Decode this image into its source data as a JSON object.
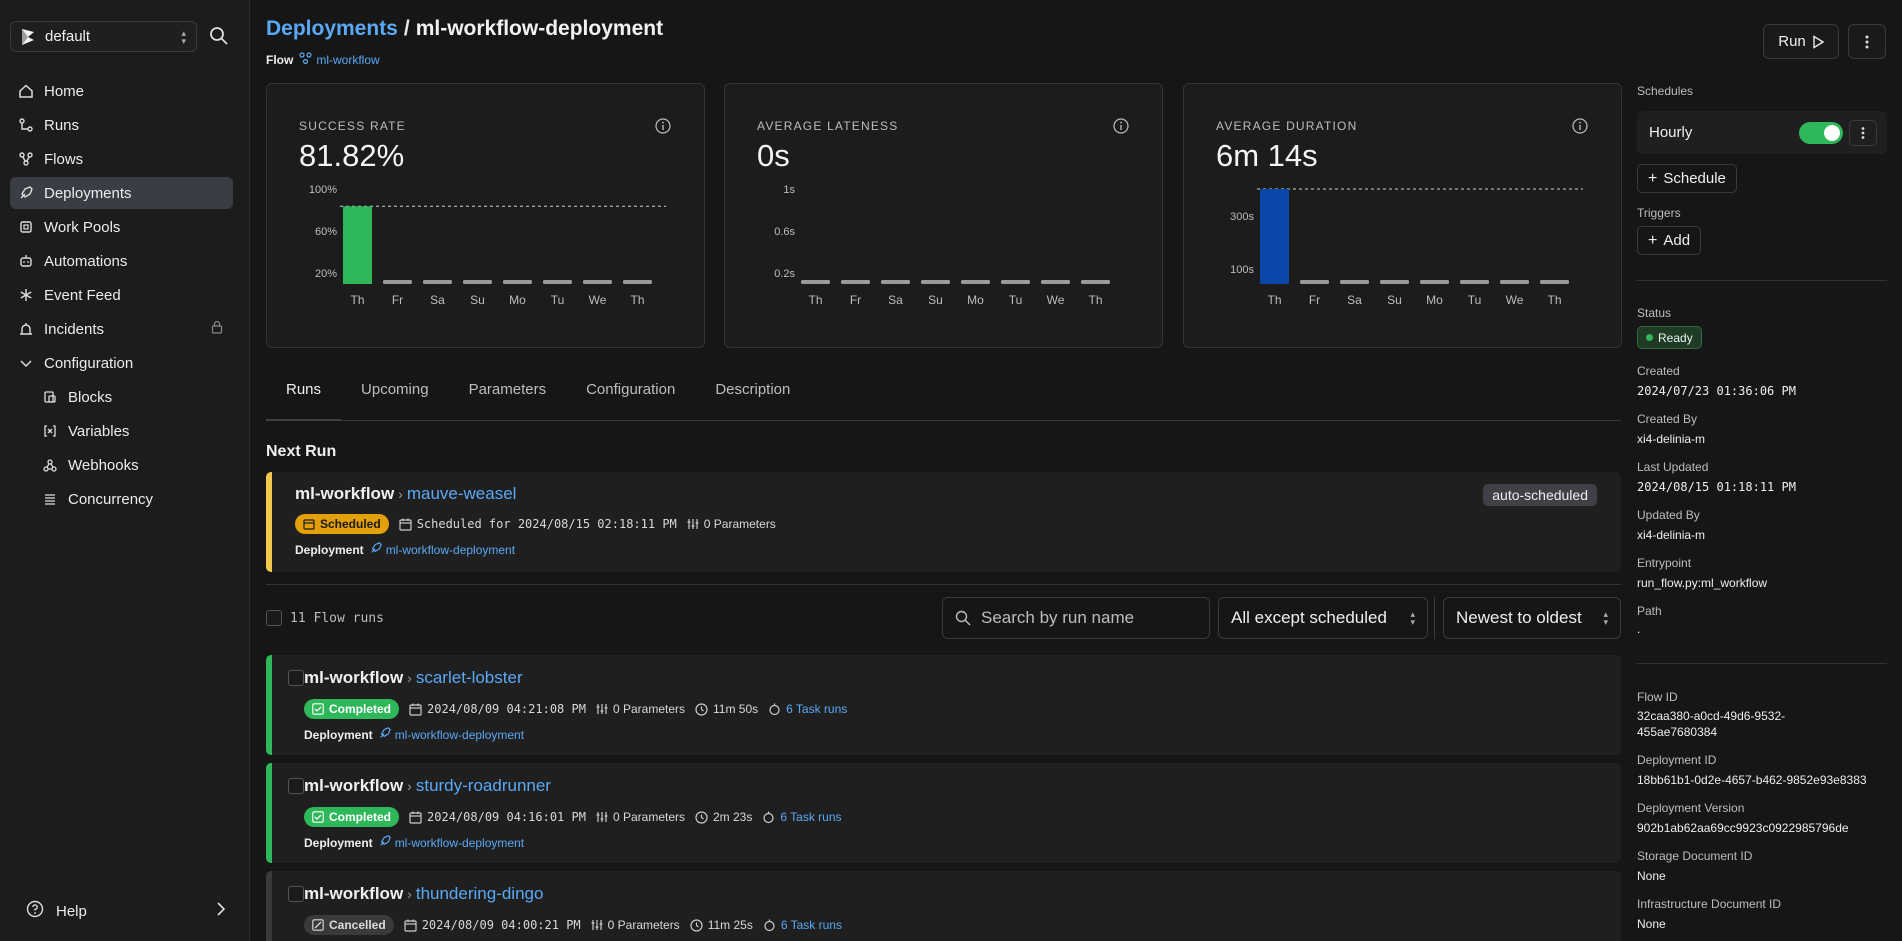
{
  "sidebar": {
    "workspace": "default",
    "items": [
      {
        "label": "Home",
        "icon": "home-icon"
      },
      {
        "label": "Runs",
        "icon": "runs-icon"
      },
      {
        "label": "Flows",
        "icon": "flows-icon"
      },
      {
        "label": "Deployments",
        "icon": "deployments-icon",
        "active": true
      },
      {
        "label": "Work Pools",
        "icon": "work-pools-icon"
      },
      {
        "label": "Automations",
        "icon": "automations-icon"
      },
      {
        "label": "Event Feed",
        "icon": "event-feed-icon"
      },
      {
        "label": "Incidents",
        "icon": "incidents-icon",
        "locked": true
      },
      {
        "label": "Configuration",
        "icon": "chevron-down-icon"
      }
    ],
    "sub_items": [
      {
        "label": "Blocks",
        "icon": "blocks-icon"
      },
      {
        "label": "Variables",
        "icon": "variables-icon"
      },
      {
        "label": "Webhooks",
        "icon": "webhooks-icon"
      },
      {
        "label": "Concurrency",
        "icon": "concurrency-icon"
      }
    ],
    "help": "Help"
  },
  "header": {
    "crumb_root": "Deployments",
    "crumb_sep": "/",
    "crumb_current": "ml-workflow-deployment",
    "flow_label": "Flow",
    "flow_name": "ml-workflow",
    "run_label": "Run"
  },
  "stats": [
    {
      "title": "SUCCESS RATE",
      "value": "81.82%"
    },
    {
      "title": "AVERAGE LATENESS",
      "value": "0s"
    },
    {
      "title": "AVERAGE DURATION",
      "value": "6m 14s"
    }
  ],
  "chart_data": [
    {
      "type": "bar",
      "categories": [
        "Th",
        "Fr",
        "Sa",
        "Su",
        "Mo",
        "Tu",
        "We",
        "Th"
      ],
      "yticks": [
        "100%",
        "60%",
        "20%"
      ],
      "values": [
        81.82,
        0,
        0,
        0,
        0,
        0,
        0,
        0
      ],
      "reference_line": 81.82,
      "ylim": [
        0,
        100
      ],
      "color": "#2fb85a"
    },
    {
      "type": "bar",
      "categories": [
        "Th",
        "Fr",
        "Sa",
        "Su",
        "Mo",
        "Tu",
        "We",
        "Th"
      ],
      "yticks": [
        "1s",
        "0.6s",
        "0.2s"
      ],
      "values": [
        0,
        0,
        0,
        0,
        0,
        0,
        0,
        0
      ],
      "ylim": [
        0,
        1
      ],
      "color": "#9a9a9a"
    },
    {
      "type": "bar",
      "categories": [
        "Th",
        "Fr",
        "Sa",
        "Su",
        "Mo",
        "Tu",
        "We",
        "Th"
      ],
      "yticks": [
        "300s",
        "100s"
      ],
      "values": [
        374,
        0,
        0,
        0,
        0,
        0,
        0,
        0
      ],
      "reference_line": 374,
      "ylim": [
        0,
        374
      ],
      "color": "#0b47a8"
    }
  ],
  "tabs": [
    "Runs",
    "Upcoming",
    "Parameters",
    "Configuration",
    "Description"
  ],
  "next_run": {
    "heading": "Next Run",
    "flow": "ml-workflow",
    "run": "mauve-weasel",
    "state": "Scheduled",
    "scheduled_for": "Scheduled for 2024/08/15 02:18:11 PM",
    "params": "0 Parameters",
    "deployment_label": "Deployment",
    "deployment": "ml-workflow-deployment",
    "tag": "auto-scheduled"
  },
  "runs_list": {
    "count": "11 Flow runs",
    "search_placeholder": "Search by run name",
    "filter": "All except scheduled",
    "sort": "Newest to oldest",
    "items": [
      {
        "flow": "ml-workflow",
        "run": "scarlet-lobster",
        "state": "Completed",
        "time": "2024/08/09 04:21:08 PM",
        "params": "0 Parameters",
        "duration": "11m 50s",
        "tasks": "6 Task runs",
        "deployment_label": "Deployment",
        "deployment": "ml-workflow-deployment"
      },
      {
        "flow": "ml-workflow",
        "run": "sturdy-roadrunner",
        "state": "Completed",
        "time": "2024/08/09 04:16:01 PM",
        "params": "0 Parameters",
        "duration": "2m 23s",
        "tasks": "6 Task runs",
        "deployment_label": "Deployment",
        "deployment": "ml-workflow-deployment"
      },
      {
        "flow": "ml-workflow",
        "run": "thundering-dingo",
        "state": "Cancelled",
        "time": "2024/08/09 04:00:21 PM",
        "params": "0 Parameters",
        "duration": "11m 25s",
        "tasks": "6 Task runs"
      }
    ]
  },
  "right_panel": {
    "schedules_label": "Schedules",
    "schedule_name": "Hourly",
    "schedule_enabled": true,
    "add_schedule": "Schedule",
    "triggers_label": "Triggers",
    "add_trigger": "Add",
    "status_label": "Status",
    "status": "Ready",
    "created_label": "Created",
    "created": "2024/07/23 01:36:06 PM",
    "created_by_label": "Created By",
    "created_by": "xi4-delinia-m",
    "updated_label": "Last Updated",
    "updated": "2024/08/15 01:18:11 PM",
    "updated_by_label": "Updated By",
    "updated_by": "xi4-delinia-m",
    "entrypoint_label": "Entrypoint",
    "entrypoint": "run_flow.py:ml_workflow",
    "path_label": "Path",
    "path": ".",
    "flow_id_label": "Flow ID",
    "flow_id_1": "32caa380-a0cd-49d6-9532-",
    "flow_id_2": "455ae7680384",
    "deployment_id_label": "Deployment ID",
    "deployment_id": "18bb61b1-0d2e-4657-b462-9852e93e8383",
    "deployment_version_label": "Deployment Version",
    "deployment_version": "902b1ab62aa69cc9923c0922985796de",
    "storage_doc_label": "Storage Document ID",
    "storage_doc": "None",
    "infra_doc_label": "Infrastructure Document ID",
    "infra_doc": "None"
  },
  "colors": {
    "accent": "#5aa9f5",
    "completed": "#2fb85a",
    "scheduled": "#e3a008",
    "duration_bar": "#0b47a8"
  }
}
